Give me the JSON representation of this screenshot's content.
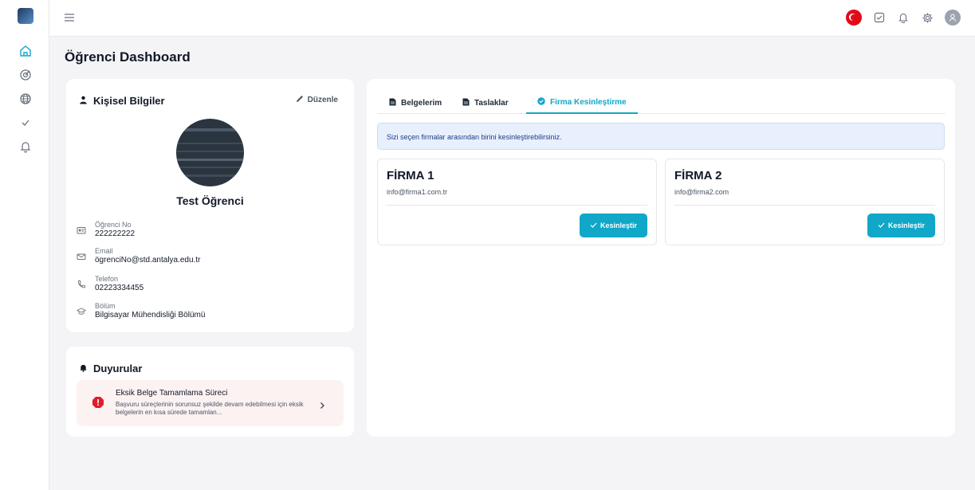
{
  "page": {
    "title": "Öğrenci Dashboard"
  },
  "sidebar": {
    "items": [
      {
        "icon": "home-icon"
      },
      {
        "icon": "target-icon"
      },
      {
        "icon": "globe-icon"
      },
      {
        "icon": "check-square-icon"
      },
      {
        "icon": "bell-icon"
      }
    ]
  },
  "topbar": {
    "icons": [
      "menu-icon",
      "turkey-flag-icon",
      "check-square-icon",
      "bell-icon",
      "gear-icon",
      "user-avatar-icon"
    ]
  },
  "profile": {
    "header": "Kişisel Bilgiler",
    "edit_label": "Düzenle",
    "name": "Test Öğrenci",
    "fields": [
      {
        "label": "Öğrenci No",
        "value": "222222222",
        "icon": "id-card-icon"
      },
      {
        "label": "Email",
        "value": "ögrenciNo@std.antalya.edu.tr",
        "icon": "mail-icon"
      },
      {
        "label": "Telefon",
        "value": "02223334455",
        "icon": "phone-icon"
      },
      {
        "label": "Bölüm",
        "value": "Bilgisayar Mühendisliği Bölümü",
        "icon": "graduation-cap-icon"
      }
    ]
  },
  "announcements": {
    "header": "Duyurular",
    "items": [
      {
        "title": "Eksik Belge Tamamlama Süreci",
        "description": "Başvuru süreçlerinin sorunsuz şekilde devam edebilmesi için eksik belgelerin en kısa sürede tamamlan..."
      }
    ]
  },
  "main": {
    "tabs": [
      {
        "label": "Belgelerim",
        "active": false
      },
      {
        "label": "Taslaklar",
        "active": false
      },
      {
        "label": "Firma Kesinleştirme",
        "active": true
      }
    ],
    "banner": "Sizi seçen firmalar arasından birini kesinleştirebilirsiniz.",
    "firms": [
      {
        "name": "FİRMA 1",
        "email": "info@firma1.com.tr",
        "button": "Kesinleştir"
      },
      {
        "name": "FİRMA 2",
        "email": "info@firma2.com",
        "button": "Kesinleştir"
      }
    ]
  },
  "colors": {
    "accent": "#10a7c8",
    "banner_bg": "#e8f0fd",
    "alert": "#e11d2b",
    "announcement_bg": "#fdf2f2"
  }
}
